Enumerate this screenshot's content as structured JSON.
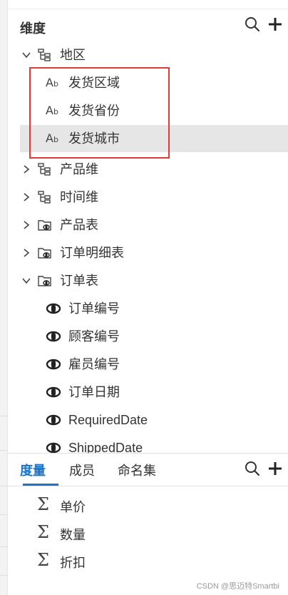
{
  "dimensions": {
    "title": "维度",
    "tree": [
      {
        "label": "地区",
        "expanded": true,
        "icon": "hierarchy-icon"
      },
      {
        "label": "发货区域",
        "icon": "text-field-icon"
      },
      {
        "label": "发货省份",
        "icon": "text-field-icon"
      },
      {
        "label": "发货城市",
        "icon": "text-field-icon",
        "selected": true
      },
      {
        "label": "产品维",
        "expanded": false,
        "icon": "hierarchy-icon"
      },
      {
        "label": "时间维",
        "expanded": false,
        "icon": "hierarchy-icon"
      },
      {
        "label": "产品表",
        "expanded": false,
        "icon": "table-folder-icon"
      },
      {
        "label": "订单明细表",
        "expanded": false,
        "icon": "table-folder-icon"
      },
      {
        "label": "订单表",
        "expanded": true,
        "icon": "table-folder-icon"
      },
      {
        "label": "订单编号",
        "icon": "view-field-icon"
      },
      {
        "label": "顾客编号",
        "icon": "view-field-icon"
      },
      {
        "label": "雇员编号",
        "icon": "view-field-icon"
      },
      {
        "label": "订单日期",
        "icon": "view-field-icon"
      },
      {
        "label": "RequiredDate",
        "icon": "view-field-icon"
      },
      {
        "label": "ShippedDate",
        "icon": "view-field-icon"
      }
    ]
  },
  "tabs": [
    {
      "label": "度量",
      "active": true
    },
    {
      "label": "成员",
      "active": false
    },
    {
      "label": "命名集",
      "active": false
    }
  ],
  "measures": [
    {
      "label": "单价",
      "icon": "sigma-icon"
    },
    {
      "label": "数量",
      "icon": "sigma-icon"
    },
    {
      "label": "折扣",
      "icon": "sigma-icon"
    }
  ],
  "ab_glyph": {
    "big": "A",
    "small": "b"
  },
  "sigma_glyph": "Σ",
  "watermark": "CSDN @思迈特Smartbi",
  "colors": {
    "accent": "#1a73c8",
    "highlight": "#e53935",
    "selected_bg": "#e6e6e6"
  }
}
